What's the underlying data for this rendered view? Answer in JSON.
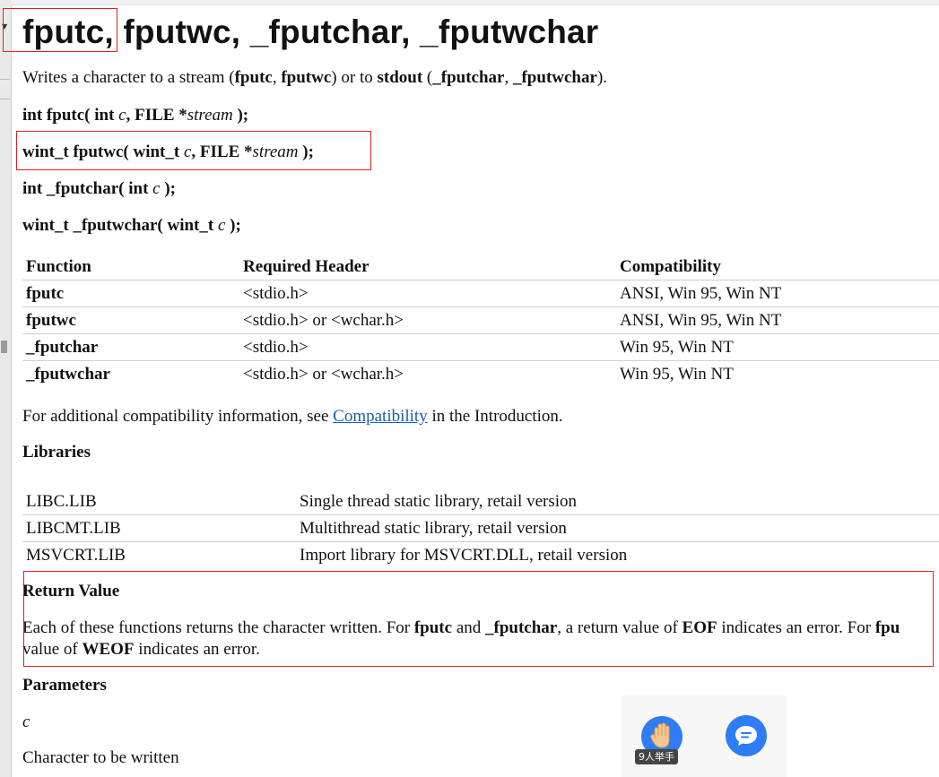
{
  "title": "fputc, fputwc, _fputchar, _fputwchar",
  "intro": {
    "prefix": "Writes a character to a stream (",
    "fputc": "fputc",
    "sep1": ", ",
    "fputwc": "fputwc",
    "mid": ") or to ",
    "stdout": "stdout",
    "open": " (",
    "fputchar": "_fputchar",
    "sep2": ", ",
    "fputwchar": "_fputwchar",
    "end": ")."
  },
  "syntax": [
    {
      "pre": "int fputc( int ",
      "arg1": "c",
      "mid": ", FILE *",
      "arg2": "stream",
      "post": " );"
    },
    {
      "pre": "wint_t fputwc( wint_t ",
      "arg1": "c",
      "mid": ", FILE *",
      "arg2": "stream",
      "post": " );"
    },
    {
      "pre": "int _fputchar( int ",
      "arg1": "c",
      "post": " );"
    },
    {
      "pre": "wint_t _fputwchar( wint_t ",
      "arg1": "c",
      "post": " );"
    }
  ],
  "requirements": {
    "headers": [
      "Function",
      "Required Header",
      "Compatibility"
    ],
    "rows": [
      [
        "fputc",
        "<stdio.h>",
        "ANSI, Win 95, Win NT"
      ],
      [
        "fputwc",
        "<stdio.h> or <wchar.h>",
        "ANSI, Win 95, Win NT"
      ],
      [
        "_fputchar",
        "<stdio.h>",
        "Win 95, Win NT"
      ],
      [
        "_fputwchar",
        "<stdio.h> or <wchar.h>",
        "Win 95, Win NT"
      ]
    ]
  },
  "compat_note": {
    "prefix": "For additional compatibility information, see ",
    "link": "Compatibility",
    "suffix": " in the Introduction."
  },
  "libraries": {
    "heading": "Libraries",
    "rows": [
      [
        "LIBC.LIB",
        "Single thread static library, retail version"
      ],
      [
        "LIBCMT.LIB",
        "Multithread static library, retail version"
      ],
      [
        "MSVCRT.LIB",
        "Import library for MSVCRT.DLL, retail version"
      ]
    ]
  },
  "return_value": {
    "heading": "Return Value",
    "t1": "Each of these functions returns the character written. For ",
    "b1": "fputc",
    "t2": " and ",
    "b2": "_fputchar",
    "t3": ", a return value of ",
    "b3": "EOF",
    "t4": " indicates an error. For ",
    "b4": "fpu",
    "t5": "value of ",
    "b5": "WEOF",
    "t6": " indicates an error."
  },
  "parameters": {
    "heading": "Parameters",
    "name": "c",
    "desc": "Character to be written"
  },
  "overlay": {
    "raise_hand_label": "9人举手",
    "accent": "#2f7cf6"
  },
  "annotation_color": "#e02020",
  "link_color": "#1a5ea8"
}
